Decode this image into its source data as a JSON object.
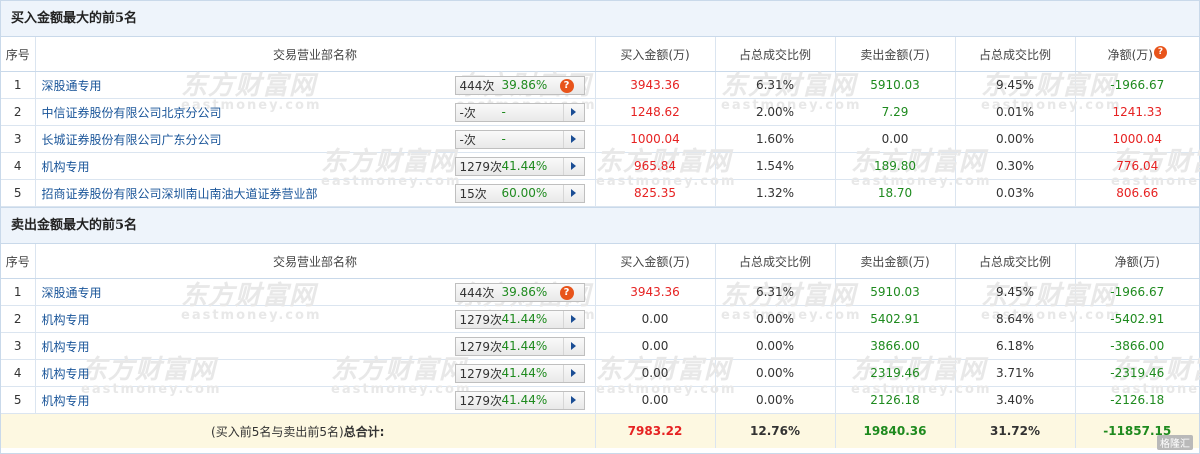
{
  "watermark": {
    "cn": "东方财富网",
    "en": "eastmoney.com"
  },
  "buy_section": {
    "title": "买入金额最大的前5名",
    "columns": [
      "序号",
      "交易营业部名称",
      "买入金额(万)",
      "占总成交比例",
      "卖出金额(万)",
      "占总成交比例",
      "净额(万)"
    ],
    "rows": [
      {
        "rank": "1",
        "name": "深股通专用",
        "count": "444次",
        "pct": "39.86%",
        "badge_icon": "question-icon",
        "buy": "3943.36",
        "buy_ratio": "6.31%",
        "sell": "5910.03",
        "sell_ratio": "9.45%",
        "net": "-1966.67",
        "net_color": "green"
      },
      {
        "rank": "2",
        "name": "中信证券股份有限公司北京分公司",
        "count": "-次",
        "pct": "-",
        "badge_icon": "arrow",
        "buy": "1248.62",
        "buy_ratio": "2.00%",
        "sell": "7.29",
        "sell_ratio": "0.01%",
        "net": "1241.33",
        "net_color": "red"
      },
      {
        "rank": "3",
        "name": "长城证券股份有限公司广东分公司",
        "count": "-次",
        "pct": "-",
        "badge_icon": "arrow",
        "buy": "1000.04",
        "buy_ratio": "1.60%",
        "sell": "0.00",
        "sell_ratio": "0.00%",
        "net": "1000.04",
        "net_color": "red"
      },
      {
        "rank": "4",
        "name": "机构专用",
        "count": "1279次",
        "pct": "41.44%",
        "badge_icon": "arrow",
        "buy": "965.84",
        "buy_ratio": "1.54%",
        "sell": "189.80",
        "sell_ratio": "0.30%",
        "net": "776.04",
        "net_color": "red"
      },
      {
        "rank": "5",
        "name": "招商证券股份有限公司深圳南山南油大道证券营业部",
        "count": "15次",
        "pct": "60.00%",
        "pct_color": "red",
        "badge_icon": "arrow",
        "buy": "825.35",
        "buy_ratio": "1.32%",
        "sell": "18.70",
        "sell_ratio": "0.03%",
        "net": "806.66",
        "net_color": "red"
      }
    ]
  },
  "sell_section": {
    "title": "卖出金额最大的前5名",
    "columns": [
      "序号",
      "交易营业部名称",
      "买入金额(万)",
      "占总成交比例",
      "卖出金额(万)",
      "占总成交比例",
      "净额(万)"
    ],
    "rows": [
      {
        "rank": "1",
        "name": "深股通专用",
        "count": "444次",
        "pct": "39.86%",
        "badge_icon": "question-icon",
        "buy": "3943.36",
        "buy_ratio": "6.31%",
        "sell": "5910.03",
        "sell_ratio": "9.45%",
        "net": "-1966.67",
        "net_color": "green"
      },
      {
        "rank": "2",
        "name": "机构专用",
        "count": "1279次",
        "pct": "41.44%",
        "badge_icon": "arrow",
        "buy": "0.00",
        "buy_ratio": "0.00%",
        "sell": "5402.91",
        "sell_ratio": "8.64%",
        "net": "-5402.91",
        "net_color": "green"
      },
      {
        "rank": "3",
        "name": "机构专用",
        "count": "1279次",
        "pct": "41.44%",
        "badge_icon": "arrow",
        "buy": "0.00",
        "buy_ratio": "0.00%",
        "sell": "3866.00",
        "sell_ratio": "6.18%",
        "net": "-3866.00",
        "net_color": "green"
      },
      {
        "rank": "4",
        "name": "机构专用",
        "count": "1279次",
        "pct": "41.44%",
        "badge_icon": "arrow",
        "buy": "0.00",
        "buy_ratio": "0.00%",
        "sell": "2319.46",
        "sell_ratio": "3.71%",
        "net": "-2319.46",
        "net_color": "green"
      },
      {
        "rank": "5",
        "name": "机构专用",
        "count": "1279次",
        "pct": "41.44%",
        "badge_icon": "arrow",
        "buy": "0.00",
        "buy_ratio": "0.00%",
        "sell": "2126.18",
        "sell_ratio": "3.40%",
        "net": "-2126.18",
        "net_color": "green"
      }
    ]
  },
  "total": {
    "label_prefix": "(买入前5名与卖出前5名)",
    "label_bold": "总合计:",
    "buy": "7983.22",
    "buy_ratio": "12.76%",
    "sell": "19840.36",
    "sell_ratio": "31.72%",
    "net": "-11857.15"
  },
  "header_help_icon": "question-icon",
  "corner_logo": "格隆汇",
  "colors": {
    "red": "#e62222",
    "green": "#1e8a1e",
    "link": "#1a5599",
    "header_bg": "#eef4fb",
    "total_bg": "#fdf8e1",
    "badge_icon": "#e8541b"
  }
}
